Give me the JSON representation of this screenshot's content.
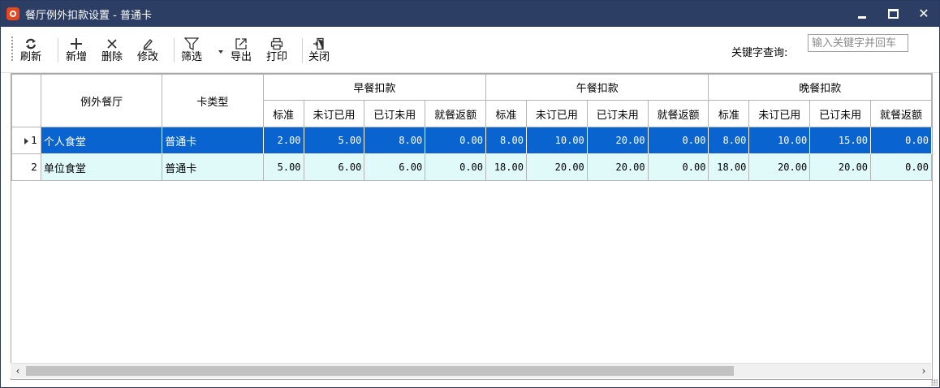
{
  "window": {
    "title": "餐厅例外扣款设置 - 普通卡"
  },
  "toolbar": {
    "refresh": "刷新",
    "add": "新增",
    "delete": "删除",
    "edit": "修改",
    "filter": "筛选",
    "export": "导出",
    "print": "打印",
    "close": "关闭"
  },
  "search": {
    "label": "关键字查询:",
    "placeholder": "输入关键字并回车"
  },
  "table": {
    "col_restaurant": "例外餐厅",
    "col_cardtype": "卡类型",
    "groups": [
      "早餐扣款",
      "午餐扣款",
      "晚餐扣款"
    ],
    "sub": [
      "标准",
      "未订已用",
      "已订未用",
      "就餐返额"
    ],
    "rows": [
      {
        "no": "1",
        "restaurant": "个人食堂",
        "cardtype": "普通卡",
        "values": [
          "2.00",
          "5.00",
          "8.00",
          "0.00",
          "8.00",
          "10.00",
          "20.00",
          "0.00",
          "8.00",
          "10.00",
          "15.00",
          "0.00"
        ]
      },
      {
        "no": "2",
        "restaurant": "单位食堂",
        "cardtype": "普通卡",
        "values": [
          "5.00",
          "6.00",
          "6.00",
          "0.00",
          "18.00",
          "20.00",
          "20.00",
          "0.00",
          "18.00",
          "20.00",
          "20.00",
          "0.00"
        ]
      }
    ]
  },
  "icons": [
    "refresh-icon",
    "plus-icon",
    "delete-x-icon",
    "pencil-icon",
    "funnel-icon",
    "export-icon",
    "printer-icon",
    "exit-door-icon"
  ],
  "colors": {
    "titlebar": "#2d3e64",
    "selected_row": "#0a64cf",
    "alt_row": "#dffaf9",
    "app_icon": "#e8461e"
  }
}
